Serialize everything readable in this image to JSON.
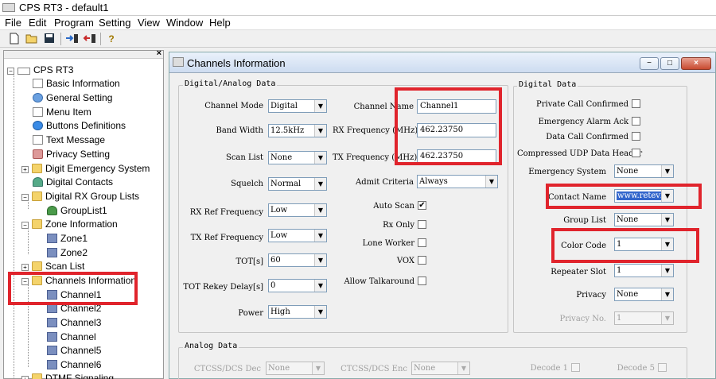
{
  "window": {
    "title": "CPS RT3 - default1",
    "icon": "app-icon"
  },
  "menu": [
    "File",
    "Edit",
    "Program",
    "Setting",
    "View",
    "Window",
    "Help"
  ],
  "toolbar": [
    "new-file-icon",
    "open-folder-icon",
    "save-icon",
    "read-radio-icon",
    "write-radio-icon",
    "help-icon"
  ],
  "tree": {
    "close": "×",
    "root": "CPS RT3",
    "expander_minus": "−",
    "expander_plus": "+",
    "items": [
      "Basic Information",
      "General Setting",
      "Menu Item",
      "Buttons Definitions",
      "Text Message",
      "Privacy Setting",
      "Digit Emergency System",
      "Digital Contacts",
      "Digital RX Group Lists",
      "GroupList1",
      "Zone Information",
      "Zone1",
      "Zone2",
      "Scan List",
      "Channels Information",
      "Channel1",
      "Channel2",
      "Channel3",
      "Channel",
      "Channel5",
      "Channel6",
      "DTMF Signaling"
    ]
  },
  "mdi": {
    "title": "Channels Information",
    "min": "−",
    "max": "□",
    "close": "×"
  },
  "da": {
    "title": "Digital/Analog Data",
    "channel_mode": {
      "label": "Channel Mode",
      "value": "Digital"
    },
    "band_width": {
      "label": "Band Width",
      "value": "12.5kHz"
    },
    "scan_list": {
      "label": "Scan List",
      "value": "None"
    },
    "squelch": {
      "label": "Squelch",
      "value": "Normal"
    },
    "rx_ref": {
      "label": "RX Ref Frequency",
      "value": "Low"
    },
    "tx_ref": {
      "label": "TX Ref Frequency",
      "value": "Low"
    },
    "tot": {
      "label": "TOT[s]",
      "value": "60"
    },
    "tot_rekey": {
      "label": "TOT Rekey Delay[s]",
      "value": "0"
    },
    "power": {
      "label": "Power",
      "value": "High"
    },
    "channel_name": {
      "label": "Channel Name",
      "value": "Channel1"
    },
    "rx_freq": {
      "label": "RX Frequency (MHz)",
      "value": "462.23750"
    },
    "tx_freq": {
      "label": "TX Frequency (MHz)",
      "value": "462.23750"
    },
    "admit": {
      "label": "Admit Criteria",
      "value": "Always"
    },
    "auto_scan": "Auto Scan",
    "rx_only": "Rx Only",
    "lone_worker": "Lone Worker",
    "vox": "VOX",
    "allow_talkaround": "Allow Talkaround",
    "check": "✔"
  },
  "dd": {
    "title": "Digital Data",
    "private_call": "Private Call Confirmed",
    "emergency_ack": "Emergency Alarm Ack",
    "data_call": "Data Call Confirmed",
    "compressed_udp": "Compressed UDP Data Header",
    "emergency_system": {
      "label": "Emergency System",
      "value": "None"
    },
    "contact_name": {
      "label": "Contact Name",
      "value": "www.retevis"
    },
    "group_list": {
      "label": "Group List",
      "value": "None"
    },
    "color_code": {
      "label": "Color Code",
      "value": "1"
    },
    "repeater_slot": {
      "label": "Repeater Slot",
      "value": "1"
    },
    "privacy": {
      "label": "Privacy",
      "value": "None"
    },
    "privacy_no": {
      "label": "Privacy No.",
      "value": "1"
    }
  },
  "analog": {
    "title": "Analog Data",
    "ctcss_dec": {
      "label": "CTCSS/DCS Dec",
      "value": "None"
    },
    "ctcss_enc": {
      "label": "CTCSS/DCS Enc",
      "value": "None"
    },
    "decode1": "Decode 1",
    "decode5": "Decode 5"
  },
  "glyphs": {
    "dropdown": "▼"
  },
  "highlight_color": "#e0242c"
}
